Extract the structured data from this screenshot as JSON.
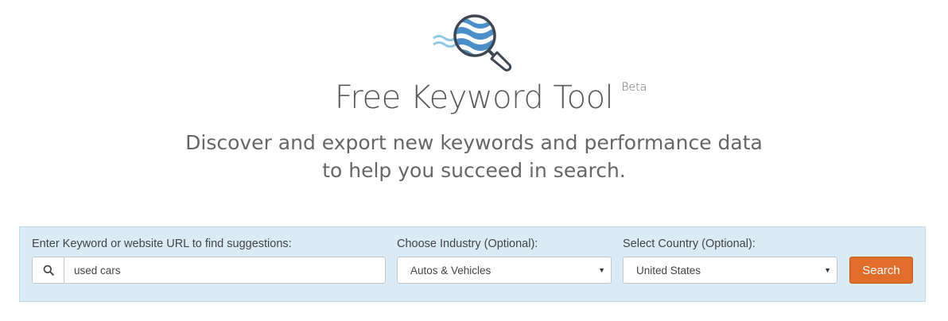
{
  "header": {
    "logo_icon": "magnifier-waves-icon",
    "title": "Free Keyword Tool",
    "badge": "Beta",
    "subtitle_line1": "Discover and export new keywords and performance data",
    "subtitle_line2": "to help you succeed in search."
  },
  "form": {
    "keyword_label": "Enter Keyword or website URL to find suggestions:",
    "keyword_value": "used cars",
    "keyword_icon": "search-icon",
    "industry_label": "Choose Industry (Optional):",
    "industry_selected": "Autos & Vehicles",
    "country_label": "Select Country (Optional):",
    "country_selected": "United States",
    "dropdown_icon": "caret-down-icon",
    "search_button": "Search"
  },
  "colors": {
    "accent": "#e06d2a",
    "panel_bg": "#d9ebf5",
    "logo_blue": "#4a8fc7",
    "logo_outline": "#3e4654"
  }
}
